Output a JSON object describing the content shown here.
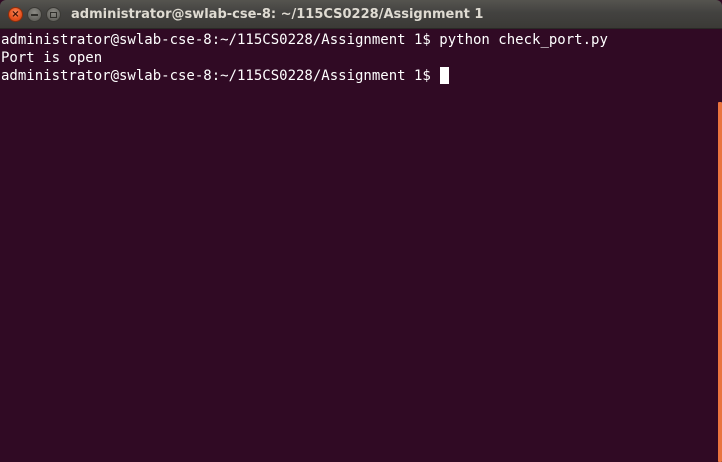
{
  "window": {
    "title": "administrator@swlab-cse-8: ~/115CS0228/Assignment 1"
  },
  "controls": {
    "close_icon": "close-icon",
    "minimize_icon": "minimize-icon",
    "maximize_icon": "maximize-icon"
  },
  "terminal": {
    "lines": [
      "administrator@swlab-cse-8:~/115CS0228/Assignment 1$ python check_port.py",
      "Port is open",
      "administrator@swlab-cse-8:~/115CS0228/Assignment 1$ "
    ],
    "background": "#300a24",
    "foreground": "#ffffff"
  },
  "colors": {
    "accent": "#e95420",
    "scrollbar": "#e9743f"
  }
}
